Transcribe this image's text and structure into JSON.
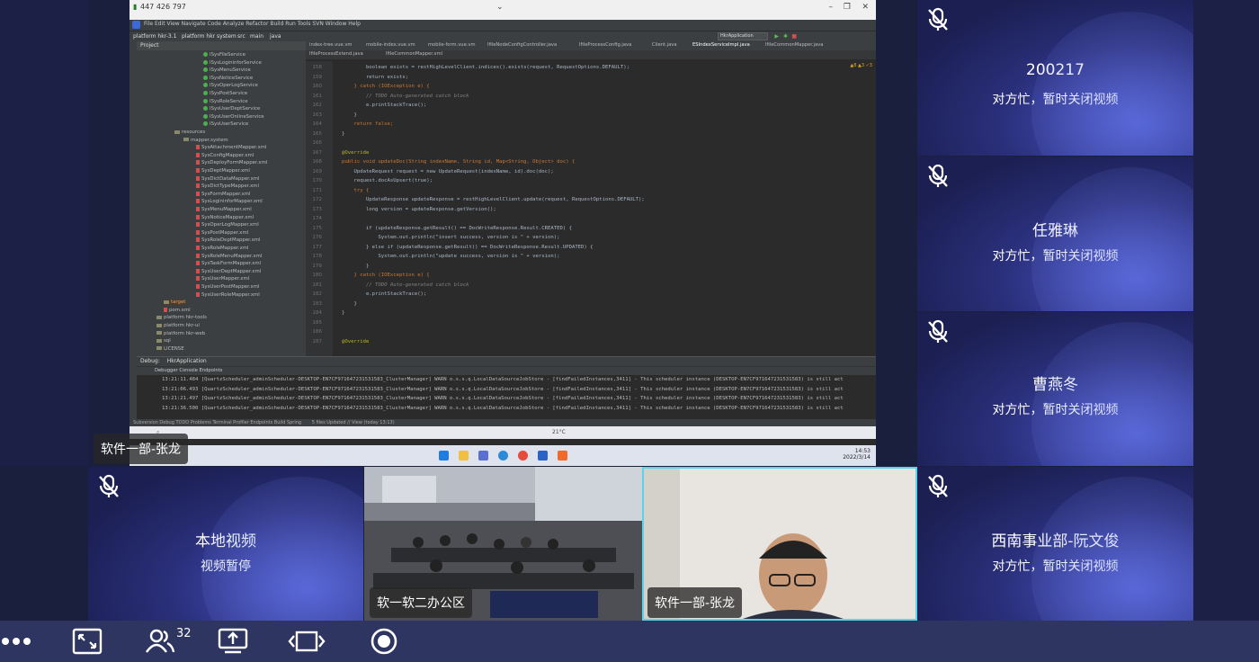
{
  "participants": [
    {
      "name": "200217",
      "status": "对方忙，暂时关闭视频"
    },
    {
      "name": "任雅琳",
      "status": "对方忙，暂时关闭视频"
    },
    {
      "name": "曹燕冬",
      "status": "对方忙，暂时关闭视频"
    },
    {
      "name": "西南事业部-阮文俊",
      "status": "对方忙，暂时关闭视频"
    }
  ],
  "local": {
    "name": "本地视频",
    "status": "视频暂停"
  },
  "video_tags": {
    "room": "软一软二办公区",
    "camera": "软件一部-张龙"
  },
  "share_tag": "软件一部-张龙",
  "toolbar": {
    "participant_count": "32"
  },
  "share": {
    "signal_text": "447 426 797",
    "ide_menu": "File  Edit  View  Navigate  Code  Analyze  Refactor  Build  Run  Tools  SVN  Window  Help",
    "breadcrumb": [
      "platform hkr-3.1",
      "platform hkr system",
      "src",
      "main",
      "java"
    ],
    "run_config": "HkrApplication",
    "project_label": "Project",
    "tabs": [
      "index-tree.vue.vm",
      "mobile-index.vue.vm",
      "mobile-form.vue.vm",
      "IfileNodeConfigController.java",
      "IfileProcessConfig.java",
      "Client.java",
      "ESIndexServiceImpl.java",
      "IfileCommonMapper.java"
    ],
    "subtabs": [
      "IfileProcessExtend.java",
      "IfileCommonMapper.xml"
    ],
    "tree_services": [
      "ISysFileService",
      "ISysLogininforService",
      "ISysMenuService",
      "ISysNoticeService",
      "ISysOperLogService",
      "ISysPostService",
      "ISysRoleService",
      "ISysUserDeptService",
      "ISysUserOnlineService",
      "ISysUserService"
    ],
    "tree_folders": [
      "resources",
      "mapper.system"
    ],
    "tree_mappers": [
      "SysAttachmentMapper.xml",
      "SysConfigMapper.xml",
      "SysDeployFormMapper.xml",
      "SysDeptMapper.xml",
      "SysDictDataMapper.xml",
      "SysDictTypeMapper.xml",
      "SysFormMapper.xml",
      "SysLogininforMapper.xml",
      "SysMenuMapper.xml",
      "SysNoticeMapper.xml",
      "SysOperLogMapper.xml",
      "SysPostMapper.xml",
      "SysRoleDeptMapper.xml",
      "SysRoleMapper.xml",
      "SysRoleMenuMapper.xml",
      "SysTaskFormMapper.xml",
      "SysUserDeptMapper.xml",
      "SysUserMapper.xml",
      "SysUserPostMapper.xml",
      "SysUserRoleMapper.xml"
    ],
    "tree_bottom": [
      "target",
      "pom.xml",
      "platform hkr-tools",
      "platform hkr-ui",
      "platform hkr-web",
      "sql",
      "LICENSE"
    ],
    "line_numbers": [
      "158",
      "159",
      "160",
      "161",
      "162",
      "163",
      "164",
      "165",
      "166",
      "167",
      "168",
      "169",
      "170",
      "171",
      "172",
      "173",
      "174",
      "175",
      "176",
      "177",
      "178",
      "179",
      "180",
      "181",
      "182",
      "183",
      "184",
      "185",
      "186",
      "187"
    ],
    "code_lines": [
      {
        "t": "        boolean exists = restHighLevelClient.indices().exists(request, RequestOptions.DEFAULT);",
        "c": ""
      },
      {
        "t": "        return exists;",
        "c": ""
      },
      {
        "t": "    } catch (IOException e) {",
        "c": "kw"
      },
      {
        "t": "        // TODO Auto-generated catch block",
        "c": "cm"
      },
      {
        "t": "        e.printStackTrace();",
        "c": ""
      },
      {
        "t": "    }",
        "c": ""
      },
      {
        "t": "    return false;",
        "c": "kw"
      },
      {
        "t": "}",
        "c": ""
      },
      {
        "t": "",
        "c": ""
      },
      {
        "t": "@Override",
        "c": "an"
      },
      {
        "t": "public void updateDoc(String indexName, String id, Map<String, Object> doc) {",
        "c": "kw"
      },
      {
        "t": "    UpdateRequest request = new UpdateRequest(indexName, id).doc(doc);",
        "c": ""
      },
      {
        "t": "    request.docAsUpsert(true);",
        "c": ""
      },
      {
        "t": "    try {",
        "c": "kw"
      },
      {
        "t": "        UpdateResponse updateResponse = restHighLevelClient.update(request, RequestOptions.DEFAULT);",
        "c": ""
      },
      {
        "t": "        long version = updateResponse.getVersion();",
        "c": ""
      },
      {
        "t": "",
        "c": ""
      },
      {
        "t": "        if (updateResponse.getResult() == DocWriteResponse.Result.CREATED) {",
        "c": ""
      },
      {
        "t": "            System.out.println(\"insert success, version is \" + version);",
        "c": ""
      },
      {
        "t": "        } else if (updateResponse.getResult() == DocWriteResponse.Result.UPDATED) {",
        "c": ""
      },
      {
        "t": "            System.out.println(\"update success, version is \" + version);",
        "c": ""
      },
      {
        "t": "        }",
        "c": ""
      },
      {
        "t": "    } catch (IOException e) {",
        "c": "kw"
      },
      {
        "t": "        // TODO Auto-generated catch block",
        "c": "cm"
      },
      {
        "t": "        e.printStackTrace();",
        "c": ""
      },
      {
        "t": "    }",
        "c": ""
      },
      {
        "t": "}",
        "c": ""
      },
      {
        "t": "",
        "c": ""
      },
      {
        "t": "",
        "c": ""
      },
      {
        "t": "@Override",
        "c": "an"
      }
    ],
    "debug_label": "Debug:",
    "debug_app": "HkrApplication",
    "debug_tabs": "Debugger   Console   Endpoints",
    "log_lines": [
      "13:21:11.484 [QuartzScheduler_adminScheduler-DESKTOP-EN7CF971647231531583_ClusterManager] WARN  o.s.s.q.LocalDataSourceJobStore - [findFailedInstances,3411] - This scheduler instance (DESKTOP-EN7CF971647231531583) is still act",
      "13:21:06.493 [QuartzScheduler_adminScheduler-DESKTOP-EN7CF971647231531583_ClusterManager] WARN  o.s.s.q.LocalDataSourceJobStore - [findFailedInstances,3411] - This scheduler instance (DESKTOP-EN7CF971647231531583) is still act",
      "13:21:21.497 [QuartzScheduler_adminScheduler-DESKTOP-EN7CF971647231531583_ClusterManager] WARN  o.s.s.q.LocalDataSourceJobStore - [findFailedInstances,3411] - This scheduler instance (DESKTOP-EN7CF971647231531583) is still act",
      "13:21:36.500 [QuartzScheduler_adminScheduler-DESKTOP-EN7CF971647231531583_ClusterManager] WARN  o.s.s.q.LocalDataSourceJobStore - [findFailedInstances,3411] - This scheduler instance (DESKTOP-EN7CF971647231531583) is still act"
    ],
    "ide_bottom_tabs": "Subversion   Debug   TODO   Problems   Terminal   Profiler   Endpoints   Build   Spring",
    "ide_status": "5 files Updated // View (today 13:13)",
    "temp": "21°C",
    "clock_time": "14:53",
    "clock_date": "2022/3/14"
  },
  "colors": {
    "accent": "#3a40a0",
    "toolbar": "#2e3561",
    "selected_border": "#5bd4e8"
  }
}
